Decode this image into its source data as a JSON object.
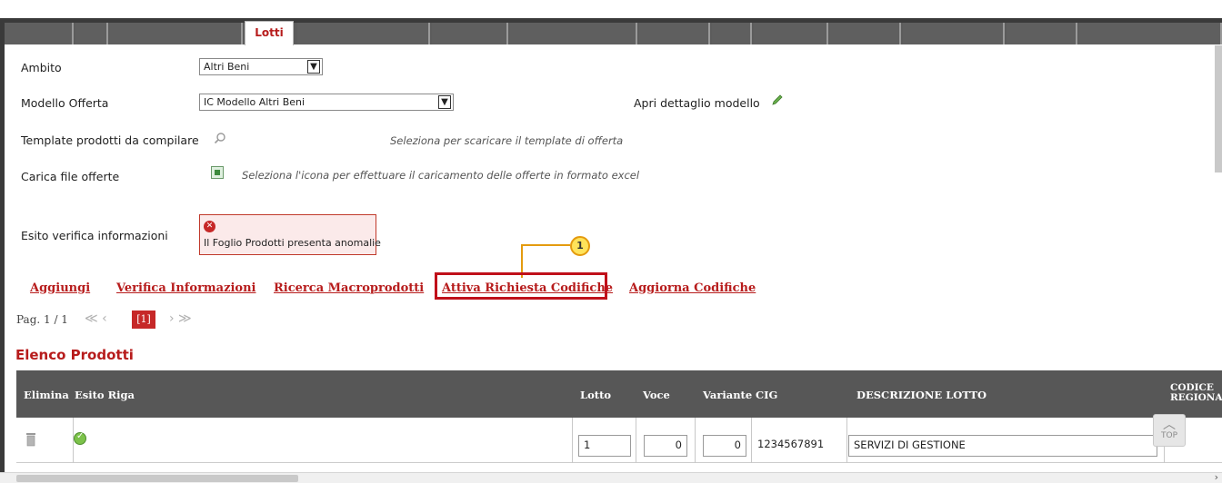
{
  "tabs": {
    "active_label": "Lotti"
  },
  "form": {
    "ambito_label": "Ambito",
    "ambito_value": "Altri Beni",
    "modello_label": "Modello Offerta",
    "modello_value": "IC Modello Altri Beni",
    "apri_dettaglio_label": "Apri dettaglio modello",
    "template_label": "Template prodotti da compilare",
    "template_hint": "Seleziona per scaricare il template di offerta",
    "carica_label": "Carica file offerte",
    "carica_hint": "Seleziona l'icona per effettuare il caricamento delle offerte in formato excel",
    "esito_label": "Esito verifica informazioni",
    "esito_message": "Il Foglio Prodotti presenta anomalie"
  },
  "callout": {
    "number": "1"
  },
  "actions": {
    "aggiungi": "Aggiungi",
    "verifica": "Verifica Informazioni",
    "ricerca": "Ricerca Macroprodotti",
    "attiva": "Attiva Richiesta Codifiche",
    "aggiorna": "Aggiorna Codifiche"
  },
  "pager": {
    "label": "Pag. 1 / 1",
    "first_prev": "≪ ‹",
    "current": "[1]",
    "next_last": "› ≫"
  },
  "section_title": "Elenco Prodotti",
  "table": {
    "headers": {
      "elimina": "Elimina",
      "esito": "Esito Riga",
      "lotto": "Lotto",
      "voce": "Voce",
      "variante": "Variante",
      "cig": "CIG",
      "descrizione": "DESCRIZIONE LOTTO",
      "codice_line1": "CODICE",
      "codice_line2": "REGIONA"
    },
    "rows": [
      {
        "lotto": "1",
        "voce": "0",
        "variante": "0",
        "cig": "1234567891",
        "descrizione": "SERVIZI DI GESTIONE"
      }
    ]
  },
  "scroll_top": "TOP",
  "colors": {
    "accent": "#b71c1c",
    "highlight": "#c0101a",
    "callout": "#e49b0f"
  }
}
